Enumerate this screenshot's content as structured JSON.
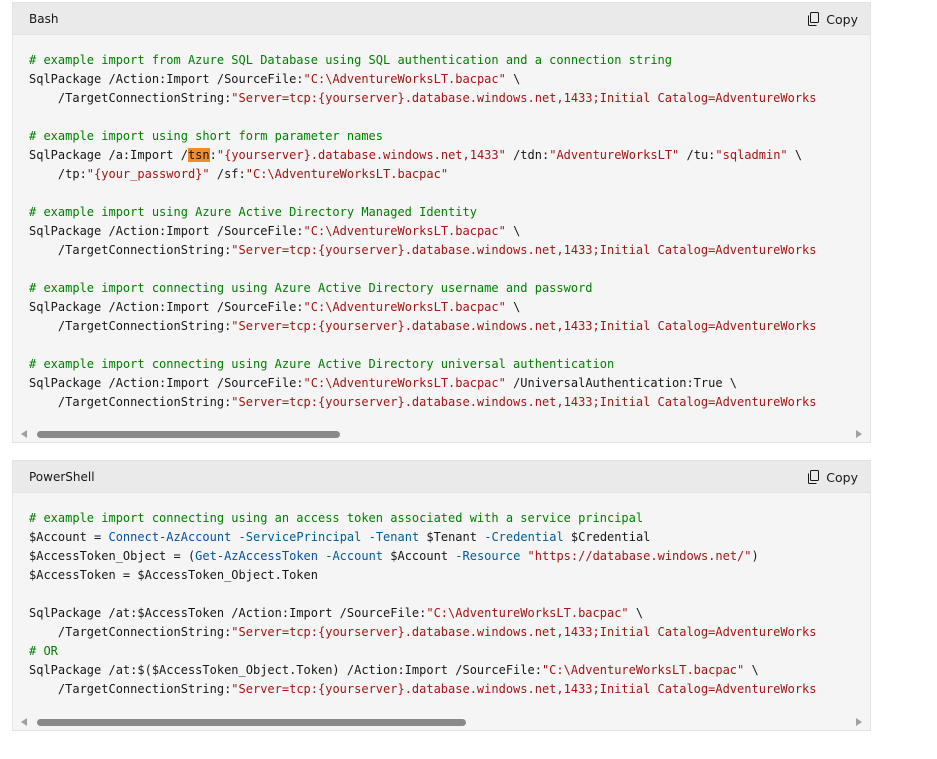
{
  "blocks": [
    {
      "language": "Bash",
      "copy_label": "Copy",
      "lines": [
        [
          {
            "t": "# example import from Azure SQL Database using SQL authentication and a connection string",
            "c": "c"
          }
        ],
        [
          {
            "t": "SqlPackage /Action:Import /SourceFile:",
            "c": "v"
          },
          {
            "t": "\"C:\\AdventureWorksLT.bacpac\"",
            "c": "s"
          },
          {
            "t": " \\",
            "c": "v"
          }
        ],
        [
          {
            "t": "    /TargetConnectionString:",
            "c": "v"
          },
          {
            "t": "\"Server=tcp:{yourserver}.database.windows.net,1433;Initial Catalog=AdventureWorks",
            "c": "s"
          }
        ],
        [],
        [
          {
            "t": "# example import using short form parameter names",
            "c": "c"
          }
        ],
        [
          {
            "t": "SqlPackage /a:Import /",
            "c": "v"
          },
          {
            "t": "tsn",
            "c": "hl"
          },
          {
            "t": ":",
            "c": "v"
          },
          {
            "t": "\"{yourserver}.database.windows.net,1433\"",
            "c": "s"
          },
          {
            "t": " /tdn:",
            "c": "v"
          },
          {
            "t": "\"AdventureWorksLT\"",
            "c": "s"
          },
          {
            "t": " /tu:",
            "c": "v"
          },
          {
            "t": "\"sqladmin\"",
            "c": "s"
          },
          {
            "t": " \\",
            "c": "v"
          }
        ],
        [
          {
            "t": "    /tp:",
            "c": "v"
          },
          {
            "t": "\"{your_password}\"",
            "c": "s"
          },
          {
            "t": " /sf:",
            "c": "v"
          },
          {
            "t": "\"C:\\AdventureWorksLT.bacpac\"",
            "c": "s"
          }
        ],
        [],
        [
          {
            "t": "# example import using Azure Active Directory Managed Identity",
            "c": "c"
          }
        ],
        [
          {
            "t": "SqlPackage /Action:Import /SourceFile:",
            "c": "v"
          },
          {
            "t": "\"C:\\AdventureWorksLT.bacpac\"",
            "c": "s"
          },
          {
            "t": " \\",
            "c": "v"
          }
        ],
        [
          {
            "t": "    /TargetConnectionString:",
            "c": "v"
          },
          {
            "t": "\"Server=tcp:{yourserver}.database.windows.net,1433;Initial Catalog=AdventureWorks",
            "c": "s"
          }
        ],
        [],
        [
          {
            "t": "# example import connecting using Azure Active Directory username and password",
            "c": "c"
          }
        ],
        [
          {
            "t": "SqlPackage /Action:Import /SourceFile:",
            "c": "v"
          },
          {
            "t": "\"C:\\AdventureWorksLT.bacpac\"",
            "c": "s"
          },
          {
            "t": " \\",
            "c": "v"
          }
        ],
        [
          {
            "t": "    /TargetConnectionString:",
            "c": "v"
          },
          {
            "t": "\"Server=tcp:{yourserver}.database.windows.net,1433;Initial Catalog=AdventureWorks",
            "c": "s"
          }
        ],
        [],
        [
          {
            "t": "# example import connecting using Azure Active Directory universal authentication",
            "c": "c"
          }
        ],
        [
          {
            "t": "SqlPackage /Action:Import /SourceFile:",
            "c": "v"
          },
          {
            "t": "\"C:\\AdventureWorksLT.bacpac\"",
            "c": "s"
          },
          {
            "t": " /UniversalAuthentication:True \\",
            "c": "v"
          }
        ],
        [
          {
            "t": "    /TargetConnectionString:",
            "c": "v"
          },
          {
            "t": "\"Server=tcp:{yourserver}.database.windows.net,1433;Initial Catalog=AdventureWorks",
            "c": "s"
          }
        ]
      ]
    },
    {
      "language": "PowerShell",
      "copy_label": "Copy",
      "lines": [
        [
          {
            "t": "# example import connecting using an access token associated with a service principal",
            "c": "c"
          }
        ],
        [
          {
            "t": "$Account = ",
            "c": "v"
          },
          {
            "t": "Connect-AzAccount",
            "c": "f"
          },
          {
            "t": " ",
            "c": "v"
          },
          {
            "t": "-ServicePrincipal",
            "c": "p"
          },
          {
            "t": " ",
            "c": "v"
          },
          {
            "t": "-Tenant",
            "c": "p"
          },
          {
            "t": " $Tenant ",
            "c": "v"
          },
          {
            "t": "-Credential",
            "c": "p"
          },
          {
            "t": " $Credential",
            "c": "v"
          }
        ],
        [
          {
            "t": "$AccessToken_Object = (",
            "c": "v"
          },
          {
            "t": "Get-AzAccessToken",
            "c": "f"
          },
          {
            "t": " ",
            "c": "v"
          },
          {
            "t": "-Account",
            "c": "p"
          },
          {
            "t": " $Account ",
            "c": "v"
          },
          {
            "t": "-Resource",
            "c": "p"
          },
          {
            "t": " ",
            "c": "v"
          },
          {
            "t": "\"https://database.windows.net/\"",
            "c": "s"
          },
          {
            "t": ")",
            "c": "v"
          }
        ],
        [
          {
            "t": "$AccessToken = $AccessToken_Object.Token",
            "c": "v"
          }
        ],
        [],
        [
          {
            "t": "SqlPackage /at:$AccessToken /Action:Import /SourceFile:",
            "c": "v"
          },
          {
            "t": "\"C:\\AdventureWorksLT.bacpac\"",
            "c": "s"
          },
          {
            "t": " \\",
            "c": "v"
          }
        ],
        [
          {
            "t": "    /TargetConnectionString:",
            "c": "v"
          },
          {
            "t": "\"Server=tcp:{yourserver}.database.windows.net,1433;Initial Catalog=AdventureWorks",
            "c": "s"
          }
        ],
        [
          {
            "t": "# OR",
            "c": "c"
          }
        ],
        [
          {
            "t": "SqlPackage /at:$($AccessToken_Object.Token) /Action:Import /SourceFile:",
            "c": "v"
          },
          {
            "t": "\"C:\\AdventureWorksLT.bacpac\"",
            "c": "s"
          },
          {
            "t": " \\",
            "c": "v"
          }
        ],
        [
          {
            "t": "    /TargetConnectionString:",
            "c": "v"
          },
          {
            "t": "\"Server=tcp:{yourserver}.database.windows.net,1433;Initial Catalog=AdventureWorks",
            "c": "s"
          }
        ]
      ]
    }
  ]
}
